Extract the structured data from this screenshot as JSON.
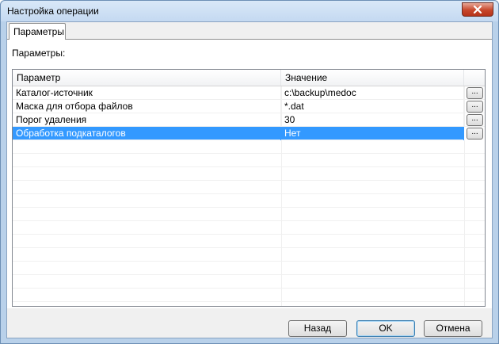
{
  "window": {
    "title": "Настройка операции"
  },
  "tabs": [
    {
      "label": "Параметры",
      "active": true
    }
  ],
  "panel": {
    "section_label": "Параметры:"
  },
  "grid": {
    "columns": {
      "param": "Параметр",
      "value": "Значение"
    },
    "rows": [
      {
        "param": "Каталог-источник",
        "value": "c:\\backup\\medoc",
        "button": "...",
        "selected": false
      },
      {
        "param": "Маска для отбора файлов",
        "value": "*.dat",
        "button": "...",
        "selected": false
      },
      {
        "param": "Порог удаления",
        "value": "30",
        "button": "...",
        "selected": false
      },
      {
        "param": "Обработка подкаталогов",
        "value": "Нет",
        "button": "...",
        "selected": true
      }
    ]
  },
  "buttons": {
    "back": "Назад",
    "ok": "OK",
    "cancel": "Отмена"
  },
  "colors": {
    "selection": "#3399ff",
    "window_frame": "#b9d1ea",
    "close_button": "#c7472b"
  },
  "icons": {
    "close": "close-icon"
  }
}
